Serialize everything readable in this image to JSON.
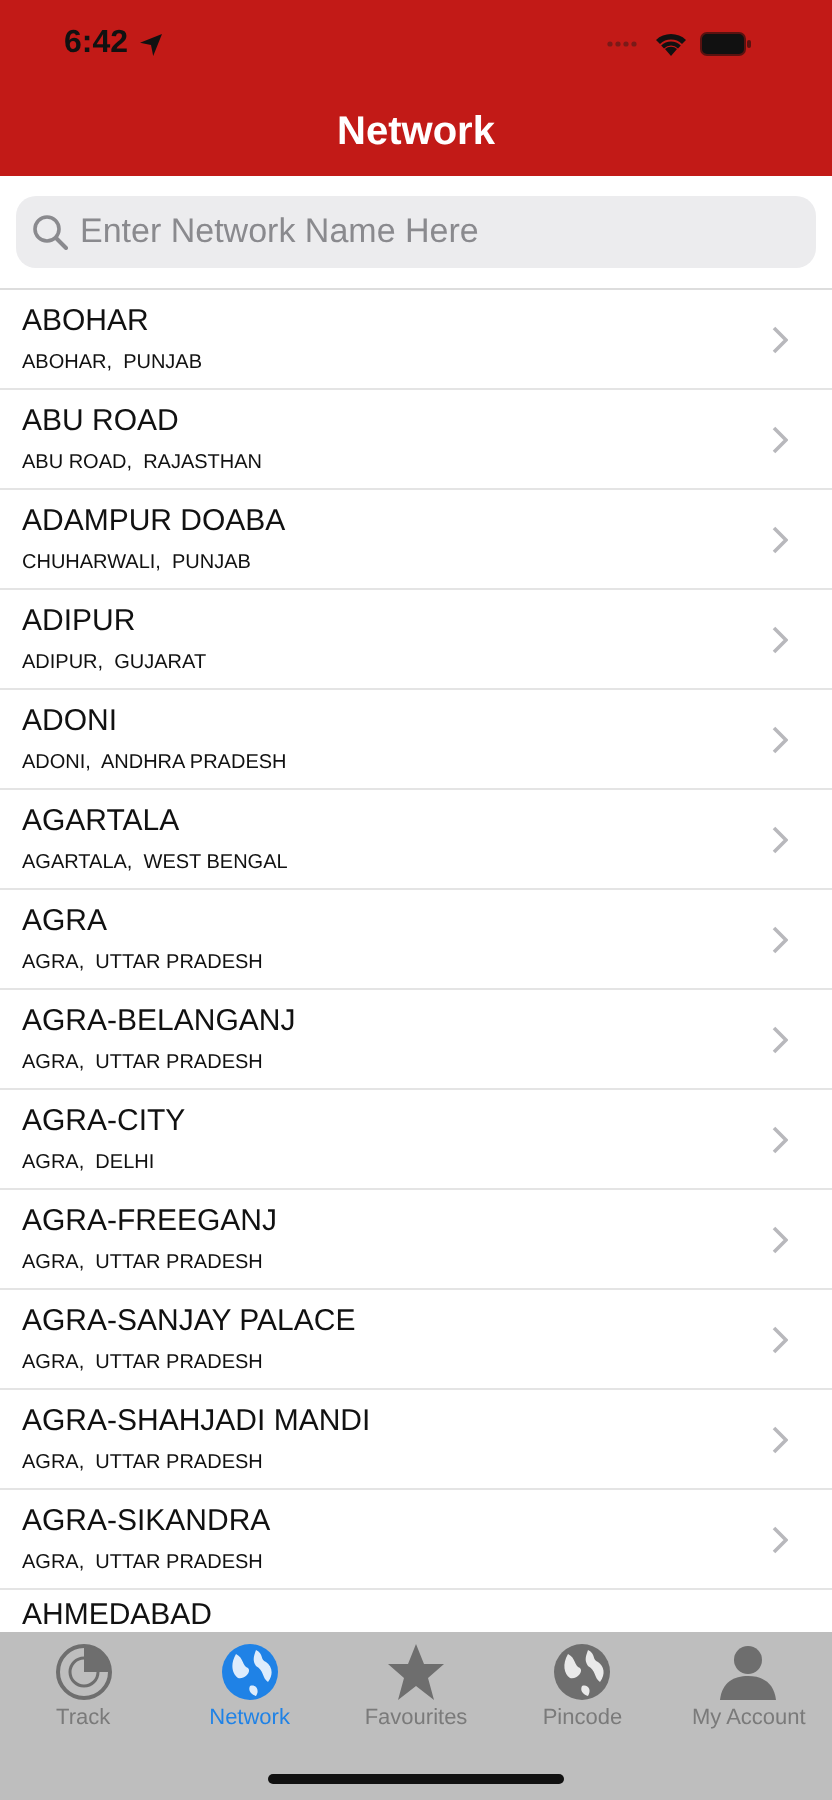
{
  "status_bar": {
    "time": "6:42"
  },
  "nav": {
    "title": "Network"
  },
  "search": {
    "placeholder": "Enter Network Name Here"
  },
  "networks": [
    {
      "name": "ABOHAR",
      "location": "ABOHAR,  PUNJAB"
    },
    {
      "name": "ABU ROAD",
      "location": "ABU ROAD,  RAJASTHAN"
    },
    {
      "name": "ADAMPUR DOABA",
      "location": "CHUHARWALI,  PUNJAB"
    },
    {
      "name": "ADIPUR",
      "location": "ADIPUR,  GUJARAT"
    },
    {
      "name": "ADONI",
      "location": "ADONI,  ANDHRA PRADESH"
    },
    {
      "name": "AGARTALA",
      "location": "AGARTALA,  WEST BENGAL"
    },
    {
      "name": "AGRA",
      "location": "AGRA,  UTTAR PRADESH"
    },
    {
      "name": "AGRA-BELANGANJ",
      "location": "AGRA,  UTTAR PRADESH"
    },
    {
      "name": "AGRA-CITY",
      "location": "AGRA,  DELHI"
    },
    {
      "name": "AGRA-FREEGANJ",
      "location": "AGRA,  UTTAR PRADESH"
    },
    {
      "name": "AGRA-SANJAY PALACE",
      "location": "AGRA,  UTTAR PRADESH"
    },
    {
      "name": "AGRA-SHAHJADI MANDI",
      "location": "AGRA,  UTTAR PRADESH"
    },
    {
      "name": "AGRA-SIKANDRA",
      "location": "AGRA,  UTTAR PRADESH"
    },
    {
      "name": "AHMEDABAD"
    }
  ],
  "tabs": [
    {
      "kind": "radar",
      "label": "Track",
      "selected": false
    },
    {
      "kind": "globe",
      "label": "Network",
      "selected": true
    },
    {
      "kind": "star",
      "label": "Favourites",
      "selected": false
    },
    {
      "kind": "globe",
      "label": "Pincode",
      "selected": false
    },
    {
      "kind": "person",
      "label": "My Account",
      "selected": false
    }
  ]
}
